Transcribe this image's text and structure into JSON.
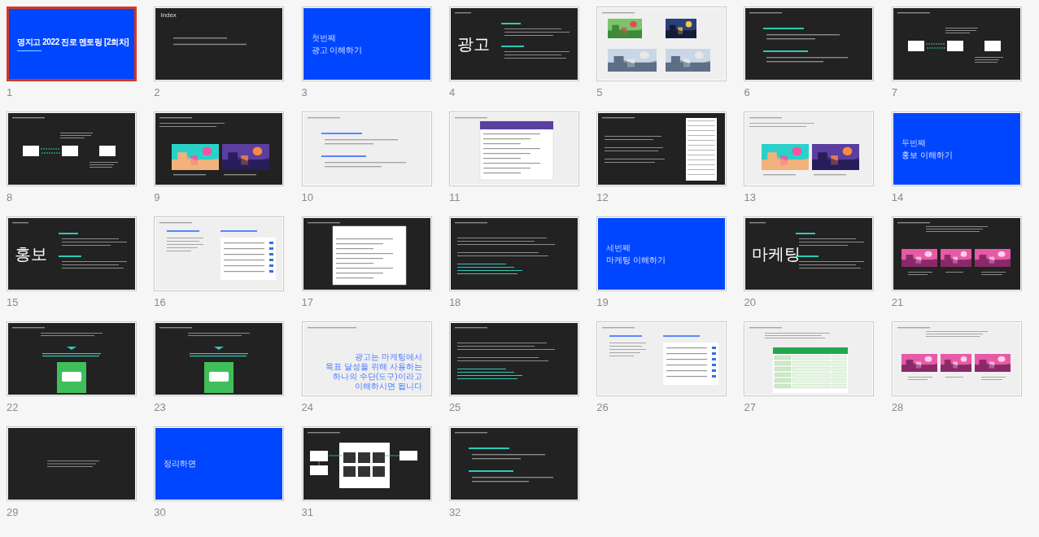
{
  "slides": [
    {
      "number": "1",
      "color": "#0046ff",
      "kind": "cover",
      "title": "명지고 2022 진로 멘토링 [2회차]",
      "bold": true,
      "selected": true
    },
    {
      "number": "2",
      "color": "#222222",
      "kind": "index",
      "heading": "Index",
      "selected": false
    },
    {
      "number": "3",
      "color": "#0046ff",
      "kind": "cover",
      "kicker": "첫번째",
      "title": "광고 이해하기",
      "bold": false,
      "selected": false
    },
    {
      "number": "4",
      "color": "#222222",
      "kind": "definition",
      "big_word": "광고",
      "selected": false
    },
    {
      "number": "5",
      "color": "#efefef",
      "kind": "four-pictures",
      "selected": false
    },
    {
      "number": "6",
      "color": "#222222",
      "kind": "sections",
      "selected": false
    },
    {
      "number": "7",
      "color": "#222222",
      "kind": "flow",
      "selected": false
    },
    {
      "number": "8",
      "color": "#222222",
      "kind": "flow",
      "selected": false
    },
    {
      "number": "9",
      "color": "#222222",
      "kind": "two-pictures",
      "selected": false
    },
    {
      "number": "10",
      "color": "#efefef",
      "kind": "sections",
      "selected": false
    },
    {
      "number": "11",
      "color": "#efefef",
      "kind": "document",
      "selected": false
    },
    {
      "number": "12",
      "color": "#222222",
      "kind": "side-table",
      "selected": false
    },
    {
      "number": "13",
      "color": "#efefef",
      "kind": "two-pictures",
      "selected": false
    },
    {
      "number": "14",
      "color": "#0046ff",
      "kind": "cover",
      "kicker": "두번째",
      "title": "홍보 이해하기",
      "bold": false,
      "selected": false
    },
    {
      "number": "15",
      "color": "#222222",
      "kind": "definition",
      "big_word": "홍보",
      "selected": false
    },
    {
      "number": "16",
      "color": "#efefef",
      "kind": "two-columns",
      "selected": false
    },
    {
      "number": "17",
      "color": "#222222",
      "kind": "document",
      "selected": false
    },
    {
      "number": "18",
      "color": "#222222",
      "kind": "paragraphs",
      "selected": false
    },
    {
      "number": "19",
      "color": "#0046ff",
      "kind": "cover",
      "kicker": "세번째",
      "title": "마케팅 이해하기",
      "bold": false,
      "selected": false
    },
    {
      "number": "20",
      "color": "#222222",
      "kind": "definition",
      "big_word": "마케팅",
      "selected": false
    },
    {
      "number": "21",
      "color": "#222222",
      "kind": "three-pictures",
      "selected": false
    },
    {
      "number": "22",
      "color": "#222222",
      "kind": "center-card",
      "selected": false
    },
    {
      "number": "23",
      "color": "#222222",
      "kind": "center-card",
      "selected": false
    },
    {
      "number": "24",
      "color": "#efefef",
      "kind": "statement",
      "statement": [
        "광고는 마케팅에서",
        "목표 달성을 위해 사용하는",
        "하나의 수단(도구)이라고",
        "이해하시면 됩니다"
      ],
      "selected": false
    },
    {
      "number": "25",
      "color": "#222222",
      "kind": "paragraphs",
      "selected": false
    },
    {
      "number": "26",
      "color": "#efefef",
      "kind": "two-columns",
      "selected": false
    },
    {
      "number": "27",
      "color": "#efefef",
      "kind": "green-table",
      "selected": false
    },
    {
      "number": "28",
      "color": "#efefef",
      "kind": "three-pictures",
      "selected": false
    },
    {
      "number": "29",
      "color": "#222222",
      "kind": "center-lines",
      "selected": false
    },
    {
      "number": "30",
      "color": "#0046ff",
      "kind": "cover",
      "title": "정리하면",
      "bold": false,
      "selected": false
    },
    {
      "number": "31",
      "color": "#222222",
      "kind": "diagram",
      "selected": false
    },
    {
      "number": "32",
      "color": "#222222",
      "kind": "sections",
      "selected": false
    }
  ]
}
